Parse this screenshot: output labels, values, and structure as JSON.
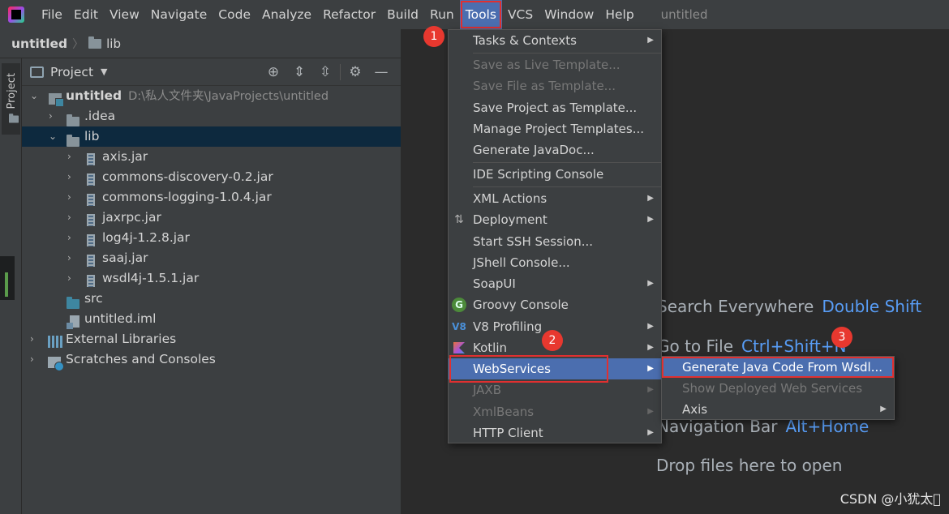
{
  "menubar": {
    "items": [
      "File",
      "Edit",
      "View",
      "Navigate",
      "Code",
      "Analyze",
      "Refactor",
      "Build",
      "Run",
      "Tools",
      "VCS",
      "Window",
      "Help"
    ],
    "window_title": "untitled"
  },
  "navbar": {
    "project": "untitled",
    "folder": "lib"
  },
  "stripe": {
    "project_tab": "Project"
  },
  "project_panel": {
    "title": "Project",
    "root": {
      "name": "untitled",
      "path": "D:\\私人文件夹\\JavaProjects\\untitled"
    },
    "items": [
      ".idea",
      "lib",
      "axis.jar",
      "commons-discovery-0.2.jar",
      "commons-logging-1.0.4.jar",
      "jaxrpc.jar",
      "log4j-1.2.8.jar",
      "saaj.jar",
      "wsdl4j-1.5.1.jar",
      "src",
      "untitled.iml",
      "External Libraries",
      "Scratches and Consoles"
    ]
  },
  "tools_menu": {
    "items": [
      "Tasks & Contexts",
      "Save as Live Template...",
      "Save File as Template...",
      "Save Project as Template...",
      "Manage Project Templates...",
      "Generate JavaDoc...",
      "IDE Scripting Console",
      "XML Actions",
      "Deployment",
      "Start SSH Session...",
      "JShell Console...",
      "SoapUI",
      "Groovy Console",
      "V8 Profiling",
      "Kotlin",
      "WebServices",
      "JAXB",
      "XmlBeans",
      "HTTP Client"
    ],
    "icons": {
      "groovy": "G",
      "v8": "V8"
    }
  },
  "webservices_submenu": {
    "items": [
      "Generate Java Code From Wsdl...",
      "Show Deployed Web Services",
      "Axis"
    ]
  },
  "editor_hints": {
    "search": {
      "label": "Search Everywhere",
      "key": "Double Shift"
    },
    "goto": {
      "label": "Go to File",
      "key": "Ctrl+Shift+N"
    },
    "navbar": {
      "label": "Navigation Bar",
      "key": "Alt+Home"
    },
    "drop": "Drop files here to open"
  },
  "badges": [
    "1",
    "2",
    "3"
  ],
  "watermark": "CSDN @小犹太\u0000",
  "colors": {
    "selection": "#4b6eaf",
    "annotation": "#e03030",
    "shortcut": "#589df6"
  }
}
